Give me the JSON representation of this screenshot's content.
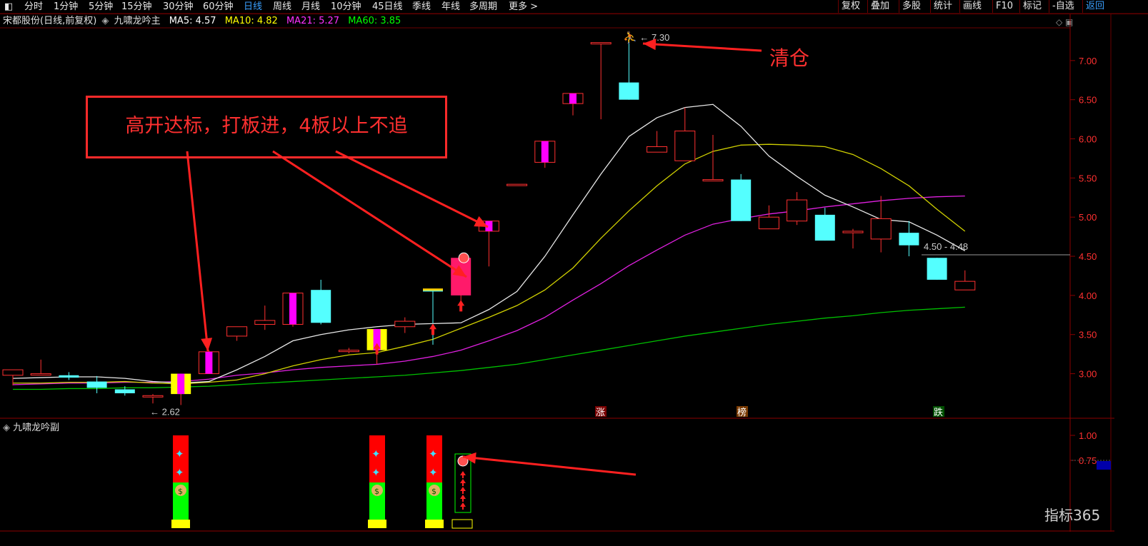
{
  "toolbar": {
    "left_items": [
      "分时",
      "1分钟",
      "5分钟",
      "15分钟",
      "30分钟",
      "60分钟",
      "日线",
      "周线",
      "月线",
      "10分钟",
      "45日线",
      "季线",
      "年线",
      "多周期",
      "更多 >"
    ],
    "active_index": 6,
    "right_items": [
      "复权",
      "叠加",
      "多股",
      "统计",
      "画线",
      "F10",
      "标记",
      "-自选",
      "返回"
    ],
    "right_active_index": 8
  },
  "info": {
    "stock": "宋都股份(日线,前复权)",
    "indicator": "九啸龙吟主",
    "ma5": "MA5: 4.57",
    "ma10": "MA10: 4.82",
    "ma21": "MA21: 5.27",
    "ma60": "MA60: 3.85",
    "ma5_color": "#ffffff",
    "ma10_color": "#ffff00",
    "ma21_color": "#ff30ff",
    "ma60_color": "#00ff00"
  },
  "sub_indicator": "九啸龙吟副",
  "annotations": {
    "callout": "高开达标，打板进，4板以上不追",
    "clear": "清仓",
    "high_label": "7.30",
    "low_label": "2.62",
    "price_range": "4.50 - 4.48"
  },
  "markers": {
    "zhang": "涨",
    "bang": "榜",
    "die": "跌"
  },
  "price_axis": [
    "7.00",
    "6.50",
    "6.00",
    "5.50",
    "5.00",
    "4.50",
    "4.00",
    "3.50",
    "3.00"
  ],
  "sub_axis": [
    "1.00",
    "0.75"
  ],
  "watermark": "指标365",
  "chart_data": {
    "type": "candlestick",
    "candles": [
      {
        "o": 2.98,
        "h": 3.05,
        "l": 2.85,
        "c": 3.05
      },
      {
        "o": 3.0,
        "h": 3.18,
        "l": 2.98,
        "c": 3.0
      },
      {
        "o": 2.98,
        "h": 3.02,
        "l": 2.92,
        "c": 2.95
      },
      {
        "o": 2.9,
        "h": 2.97,
        "l": 2.75,
        "c": 2.82
      },
      {
        "o": 2.8,
        "h": 2.84,
        "l": 2.72,
        "c": 2.75
      },
      {
        "o": 2.72,
        "h": 2.74,
        "l": 2.62,
        "c": 2.72
      },
      {
        "o": 2.74,
        "h": 3.0,
        "l": 2.6,
        "c": 3.0
      },
      {
        "o": 3.0,
        "h": 3.3,
        "l": 3.0,
        "c": 3.28
      },
      {
        "o": 3.48,
        "h": 3.6,
        "l": 3.42,
        "c": 3.6
      },
      {
        "o": 3.63,
        "h": 3.87,
        "l": 3.56,
        "c": 3.68
      },
      {
        "o": 3.63,
        "h": 4.03,
        "l": 3.6,
        "c": 4.03
      },
      {
        "o": 4.07,
        "h": 4.2,
        "l": 3.63,
        "c": 3.65
      },
      {
        "o": 3.3,
        "h": 3.33,
        "l": 3.26,
        "c": 3.3
      },
      {
        "o": 3.3,
        "h": 3.57,
        "l": 3.12,
        "c": 3.57
      },
      {
        "o": 3.6,
        "h": 3.72,
        "l": 3.52,
        "c": 3.67
      },
      {
        "o": 4.07,
        "h": 4.07,
        "l": 3.37,
        "c": 4.05
      },
      {
        "o": 4.0,
        "h": 4.48,
        "l": 3.82,
        "c": 4.48
      },
      {
        "o": 4.82,
        "h": 4.95,
        "l": 4.37,
        "c": 4.95
      },
      {
        "o": 5.42,
        "h": 5.42,
        "l": 5.42,
        "c": 5.42
      },
      {
        "o": 5.7,
        "h": 5.97,
        "l": 5.63,
        "c": 5.97
      },
      {
        "o": 6.45,
        "h": 6.58,
        "l": 6.3,
        "c": 6.58
      },
      {
        "o": 7.23,
        "h": 7.23,
        "l": 6.25,
        "c": 7.23
      },
      {
        "o": 6.72,
        "h": 7.3,
        "l": 6.5,
        "c": 6.5
      },
      {
        "o": 5.83,
        "h": 6.1,
        "l": 5.83,
        "c": 5.9
      },
      {
        "o": 5.72,
        "h": 6.4,
        "l": 5.72,
        "c": 6.1
      },
      {
        "o": 5.48,
        "h": 6.05,
        "l": 5.48,
        "c": 5.48
      },
      {
        "o": 5.48,
        "h": 5.55,
        "l": 4.95,
        "c": 4.95
      },
      {
        "o": 4.85,
        "h": 5.15,
        "l": 4.85,
        "c": 5.0
      },
      {
        "o": 4.95,
        "h": 5.32,
        "l": 4.9,
        "c": 5.22
      },
      {
        "o": 5.03,
        "h": 5.12,
        "l": 4.7,
        "c": 4.7
      },
      {
        "o": 4.8,
        "h": 4.85,
        "l": 4.6,
        "c": 4.82
      },
      {
        "o": 4.72,
        "h": 5.27,
        "l": 4.55,
        "c": 4.98
      },
      {
        "o": 4.8,
        "h": 4.95,
        "l": 4.5,
        "c": 4.64
      },
      {
        "o": 4.48,
        "h": 4.48,
        "l": 4.2,
        "c": 4.2
      },
      {
        "o": 4.07,
        "h": 4.32,
        "l": 4.07,
        "c": 4.18
      }
    ],
    "ma5": [
      2.94,
      2.95,
      2.96,
      2.96,
      2.94,
      2.9,
      2.88,
      2.9,
      3.05,
      3.22,
      3.42,
      3.5,
      3.56,
      3.6,
      3.63,
      3.64,
      3.65,
      3.82,
      4.05,
      4.5,
      5.03,
      5.55,
      6.03,
      6.27,
      6.4,
      6.44,
      6.16,
      5.78,
      5.52,
      5.28,
      5.13,
      4.97,
      4.94,
      4.77,
      4.57
    ],
    "ma10": [
      2.88,
      2.88,
      2.89,
      2.89,
      2.9,
      2.88,
      2.87,
      2.89,
      2.92,
      3.0,
      3.1,
      3.18,
      3.24,
      3.27,
      3.35,
      3.44,
      3.58,
      3.72,
      3.87,
      4.07,
      4.35,
      4.73,
      5.08,
      5.4,
      5.68,
      5.84,
      5.92,
      5.93,
      5.92,
      5.9,
      5.8,
      5.62,
      5.4,
      5.1,
      4.82
    ],
    "ma21": [
      2.86,
      2.87,
      2.88,
      2.88,
      2.89,
      2.89,
      2.9,
      2.93,
      2.98,
      3.01,
      3.05,
      3.08,
      3.1,
      3.12,
      3.16,
      3.22,
      3.3,
      3.42,
      3.55,
      3.72,
      3.94,
      4.15,
      4.38,
      4.58,
      4.77,
      4.91,
      4.98,
      5.04,
      5.08,
      5.13,
      5.17,
      5.21,
      5.24,
      5.26,
      5.27
    ],
    "ma60": [
      2.8,
      2.8,
      2.81,
      2.81,
      2.82,
      2.82,
      2.83,
      2.84,
      2.86,
      2.88,
      2.9,
      2.92,
      2.94,
      2.96,
      2.98,
      3.01,
      3.04,
      3.08,
      3.12,
      3.18,
      3.24,
      3.3,
      3.36,
      3.42,
      3.48,
      3.53,
      3.58,
      3.63,
      3.67,
      3.71,
      3.74,
      3.78,
      3.81,
      3.83,
      3.85
    ],
    "ylim": [
      2.4,
      7.4
    ]
  },
  "colors": {
    "up": "#ff3030",
    "down": "#54ffff",
    "axis": "#8b0000",
    "label": "#ff3030"
  }
}
